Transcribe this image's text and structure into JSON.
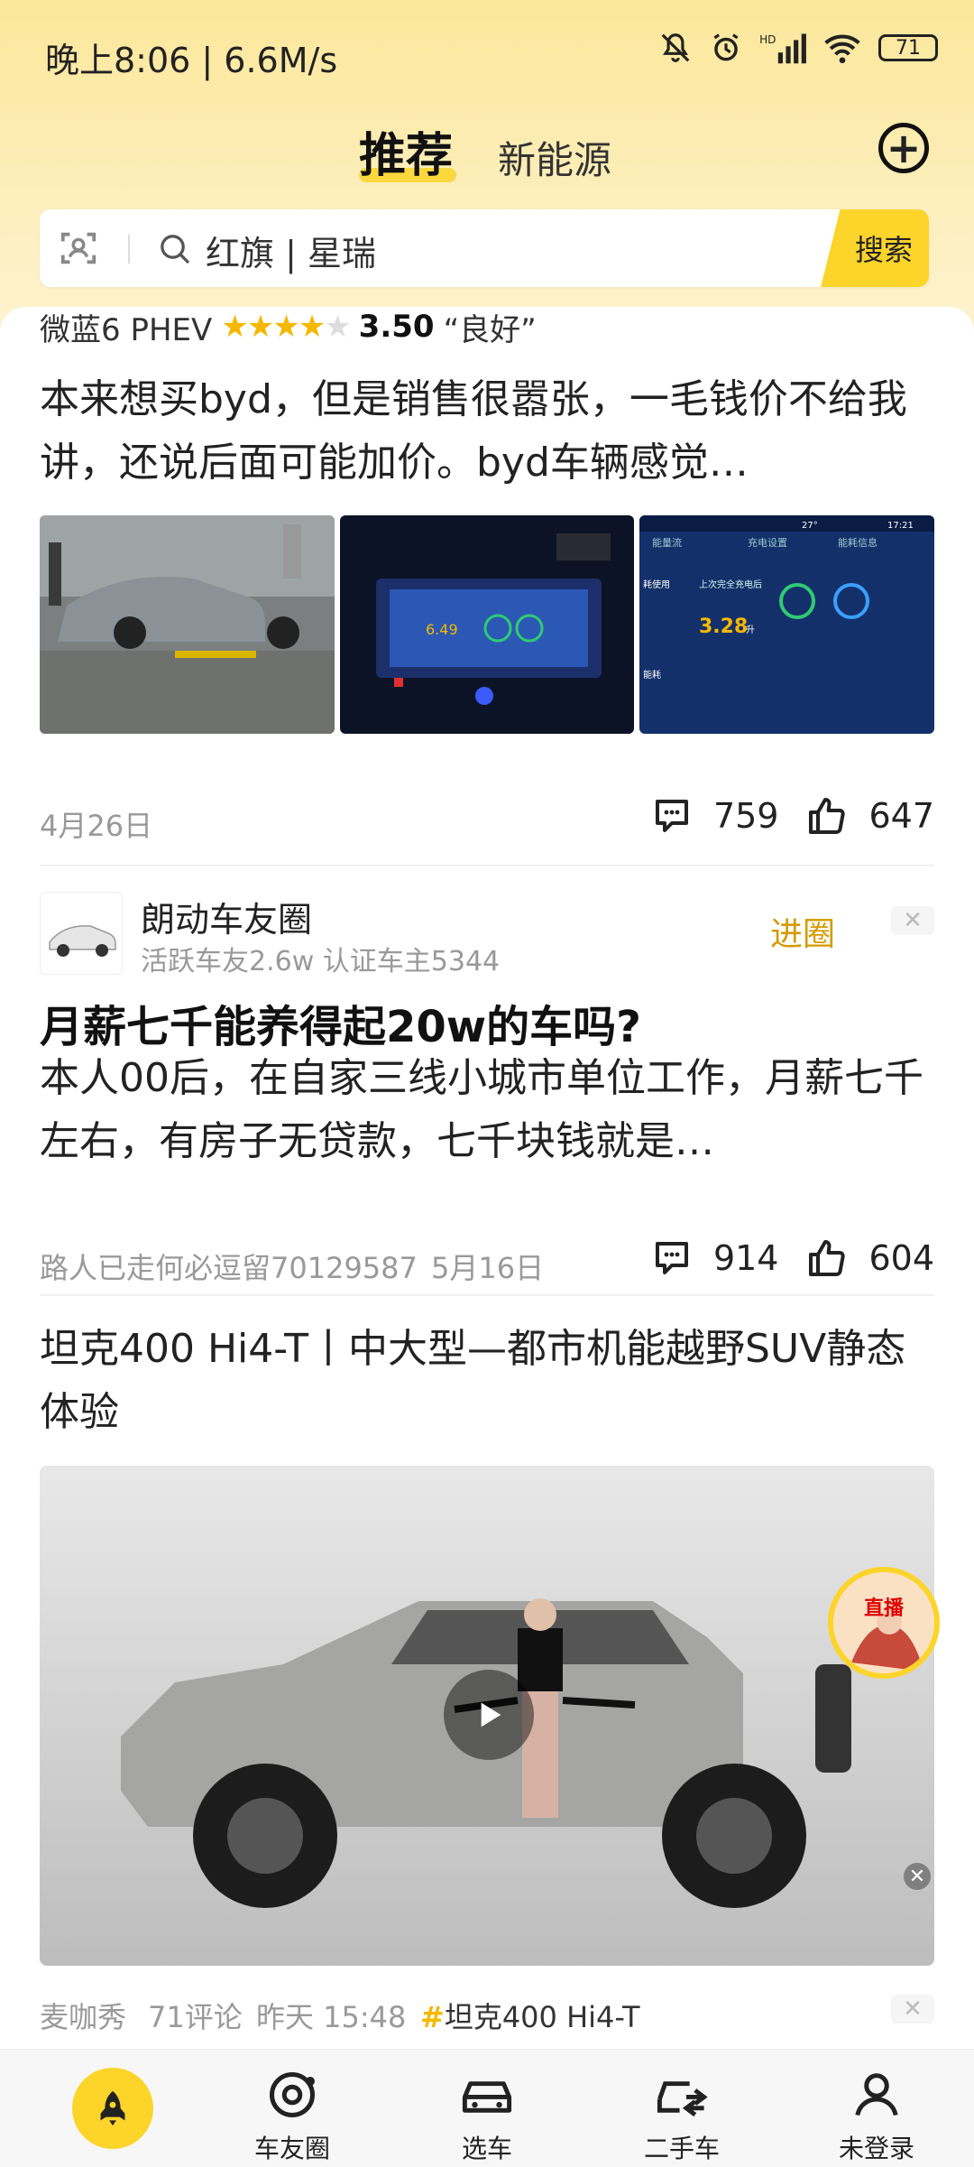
{
  "status_bar": {
    "time": "晚上8:06 | 6.6M/s",
    "battery": "71"
  },
  "top_tabs": {
    "recommend": "推荐",
    "new_energy": "新能源"
  },
  "search": {
    "placeholder": "红旗 | 星瑞",
    "button": "搜索"
  },
  "feed": {
    "post1": {
      "car": "微蓝6 PHEV",
      "rating": 3.5,
      "score": "3.50",
      "verdict": "“良好”",
      "text": "本来想买byd，但是销售很嚣张，一毛钱价不给我讲，还说后面可能加价。byd车辆感觉…",
      "date": "4月26日",
      "comments": "759",
      "likes": "647",
      "thumb2_value": "6.49",
      "thumb3_tabs": [
        "能量流",
        "充电设置",
        "能耗信息"
      ],
      "thumb3_label1": "耗使用",
      "thumb3_label2": "能耗",
      "thumb3_header": "上次完全充电后",
      "thumb3_value": "3.28",
      "thumb3_unit": "升",
      "thumb3_time": "17:21",
      "thumb3_temp": "27°"
    },
    "circle": {
      "name": "朗动车友圈",
      "stats": "活跃车友2.6w   认证车主5344",
      "join": "进圈"
    },
    "post2": {
      "title": "月薪七千能养得起20w的车吗?",
      "text": "本人00后，在自家三线小城市单位工作，月薪七千左右，有房子无贷款，七千块钱就是…",
      "author": "路人已走何必逗留70129587",
      "date": "5月16日",
      "comments": "914",
      "likes": "604"
    },
    "post3": {
      "title": "坦克400 Hi4-T丨中大型—都市机能越野SUV静态体验",
      "author": "麦咖秀",
      "comments": "71评论",
      "time": "昨天 15:48",
      "tag": "坦克400 Hi4-T"
    }
  },
  "live_badge": "直播",
  "bottom_nav": {
    "items": [
      {
        "label": "",
        "icon": "rocket-icon"
      },
      {
        "label": "车友圈",
        "icon": "circle-icon"
      },
      {
        "label": "选车",
        "icon": "car-icon"
      },
      {
        "label": "二手车",
        "icon": "used-car-icon"
      },
      {
        "label": "未登录",
        "icon": "user-icon"
      }
    ]
  },
  "colors": {
    "accent": "#fcd42a",
    "join": "#d49a00",
    "tag": "#f5b800"
  }
}
